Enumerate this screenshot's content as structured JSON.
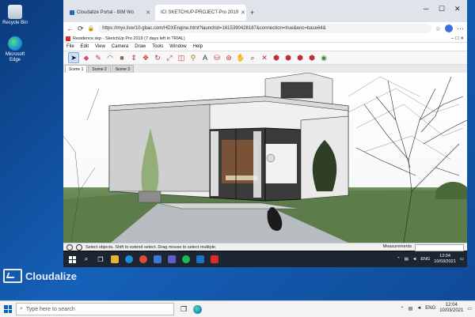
{
  "desktop": {
    "icons": [
      {
        "label": "Recycle Bin",
        "icon": "recycle-bin-icon"
      },
      {
        "label": "Microsoft Edge",
        "icon": "edge-icon"
      }
    ],
    "brand": "Cloudalize"
  },
  "browser": {
    "tabs": [
      {
        "label": "Cloudalize Portal - BIM Wo",
        "active": false
      },
      {
        "label": "ICI SKETCHUP-PROJECT-Pro 2019",
        "active": true
      }
    ],
    "new_tab": "+",
    "address": "https://myx.live/10-gbac.com/HDXEngine.html?launchid=1615390428187&connection=true&enc=base64&",
    "controls": {
      "minimize": "─",
      "maximize": "☐",
      "close": "✕"
    }
  },
  "app": {
    "title": "Residence.skp - SketchUp Pro 2019 (7 days left in TRIAL)",
    "menu": [
      "File",
      "Edit",
      "View",
      "Camera",
      "Draw",
      "Tools",
      "Window",
      "Help"
    ],
    "scenes": [
      "Scene 1",
      "Scene 2",
      "Scene 3"
    ],
    "status_text": "Select objects. Shift to extend select. Drag mouse to select multiple.",
    "measurements_label": "Measurements"
  },
  "remote_taskbar": {
    "lang": "ENG",
    "time": "12:04",
    "date": "10/03/2021"
  },
  "host_taskbar": {
    "search_placeholder": "Type here to search",
    "lang": "ENG",
    "time": "12:04",
    "date": "10/03/2021"
  },
  "colors": {
    "desktop_blue": "#1560b8",
    "sketchup_red": "#d92b2b",
    "remote_taskbar": "#1c2633"
  }
}
